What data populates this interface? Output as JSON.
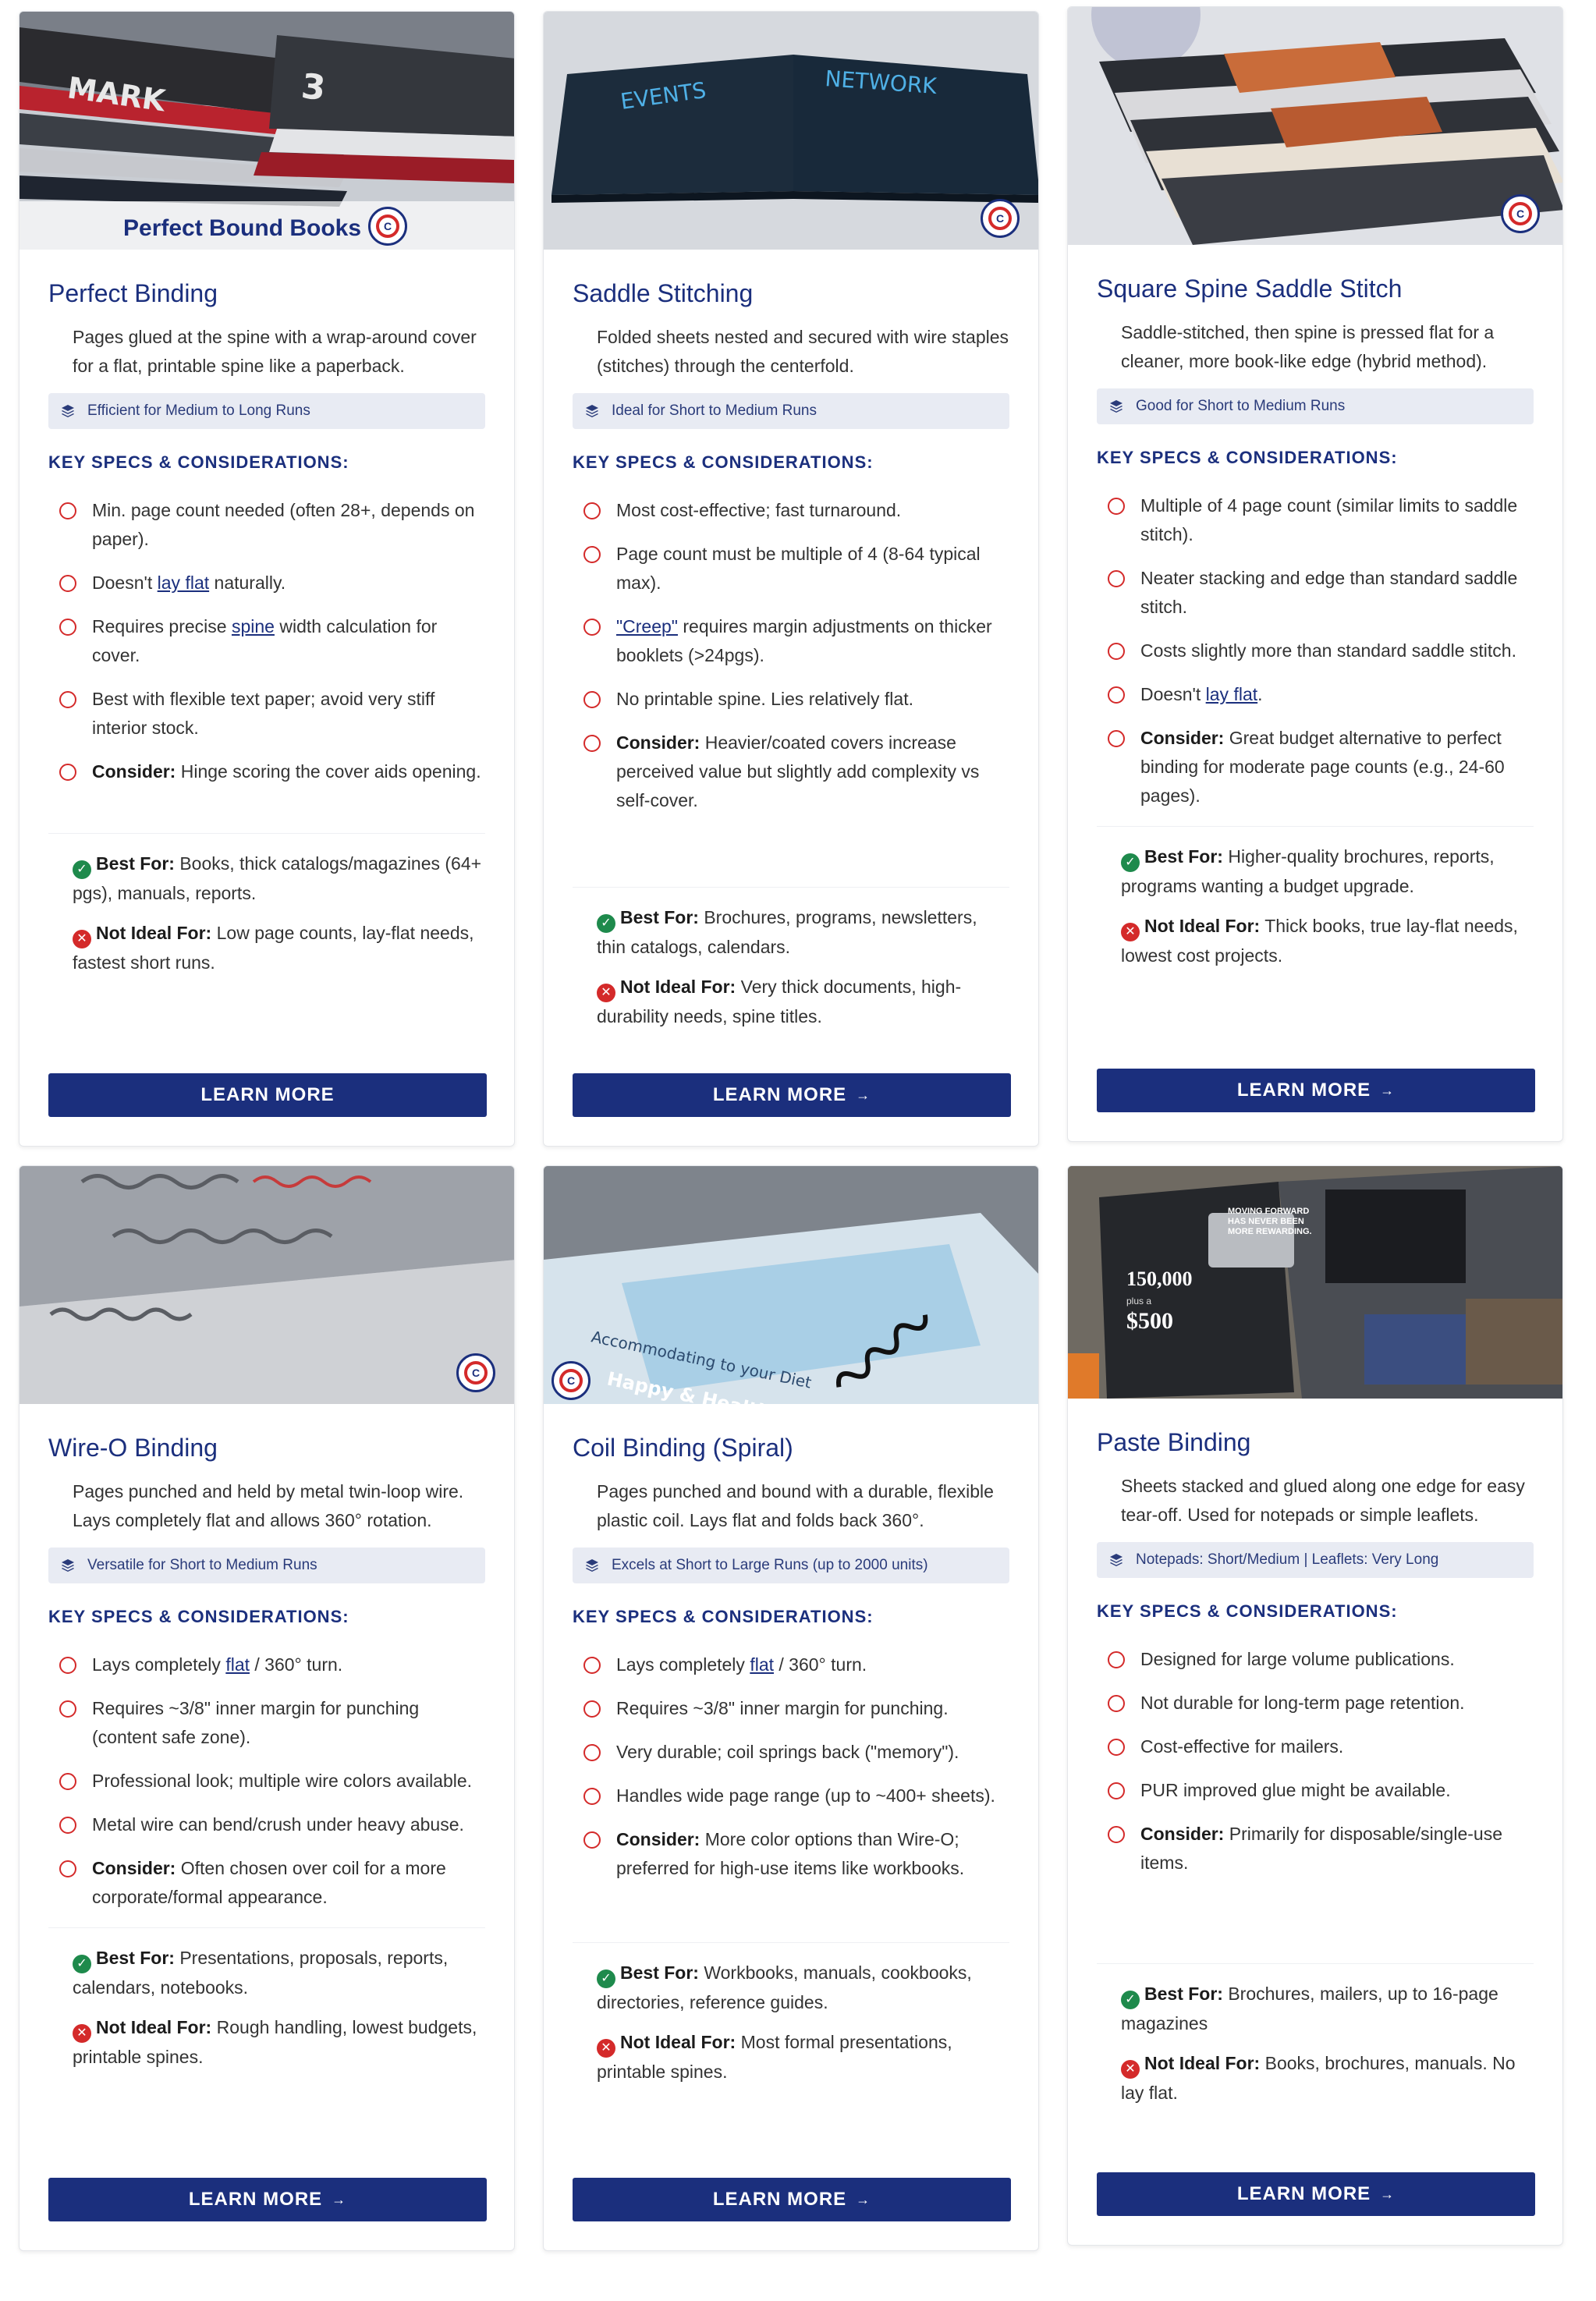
{
  "colors": {
    "brand": "#1b2f7d",
    "accent_red": "#d42a2a",
    "ok_green": "#1e8a4c"
  },
  "cards": [
    {
      "image_caption": "Perfect Bound Books",
      "title": "Perfect Binding",
      "desc": "Pages glued at the spine with a wrap-around cover for a flat, printable spine like a paperback.",
      "runs": "Efficient for Medium to Long Runs",
      "specs_heading": "KEY SPECS & CONSIDERATIONS:",
      "specs": [
        {
          "pre": "Min. page count needed (often 28+, depends on paper).",
          "link": "",
          "post": ""
        },
        {
          "pre": "Doesn't ",
          "link": "lay flat",
          "post": " naturally."
        },
        {
          "pre": "Requires precise ",
          "link": "spine",
          "post": " width calculation for cover."
        },
        {
          "pre": "Best with flexible text paper; avoid very stiff interior stock.",
          "link": "",
          "post": ""
        },
        {
          "bold": "Consider:",
          "pre": " Hinge scoring the cover aids opening.",
          "link": "",
          "post": ""
        }
      ],
      "best_label": "Best For:",
      "best": " Books, thick catalogs/magazines (64+ pgs), manuals, reports.",
      "not_label": "Not Ideal For:",
      "not": " Low page counts, lay-flat needs, fastest short runs.",
      "button": "LEARN MORE",
      "arrow": ""
    },
    {
      "title": "Saddle Stitching",
      "desc": "Folded sheets nested and secured with wire staples (stitches) through the centerfold.",
      "runs": "Ideal for Short to Medium Runs",
      "specs_heading": "KEY SPECS & CONSIDERATIONS:",
      "specs": [
        {
          "pre": "Most cost-effective; fast turnaround.",
          "link": "",
          "post": ""
        },
        {
          "pre": "Page count must be multiple of 4 (8-64 typical max).",
          "link": "",
          "post": ""
        },
        {
          "pre": "",
          "link": "\"Creep\"",
          "post": " requires margin adjustments on thicker booklets (>24pgs)."
        },
        {
          "pre": "No printable spine. Lies relatively flat.",
          "link": "",
          "post": ""
        },
        {
          "bold": "Consider:",
          "pre": " Heavier/coated covers increase perceived value but slightly add complexity vs self-cover.",
          "link": "",
          "post": ""
        }
      ],
      "best_label": "Best For:",
      "best": " Brochures, programs, newsletters, thin catalogs, calendars.",
      "not_label": "Not Ideal For:",
      "not": " Very thick documents, high-durability needs, spine titles.",
      "button": "LEARN MORE",
      "arrow": "→"
    },
    {
      "title": "Square Spine Saddle Stitch",
      "desc": "Saddle-stitched, then spine is pressed flat for a cleaner, more book-like edge (hybrid method).",
      "runs": "Good for Short to Medium Runs",
      "specs_heading": "KEY SPECS & CONSIDERATIONS:",
      "specs": [
        {
          "pre": "Multiple of 4 page count (similar limits to saddle stitch).",
          "link": "",
          "post": ""
        },
        {
          "pre": "Neater stacking and edge than standard saddle stitch.",
          "link": "",
          "post": ""
        },
        {
          "pre": "Costs slightly more than standard saddle stitch.",
          "link": "",
          "post": ""
        },
        {
          "pre": "Doesn't ",
          "link": "lay flat",
          "post": "."
        },
        {
          "bold": "Consider:",
          "pre": " Great budget alternative to perfect binding for moderate page counts (e.g., 24-60 pages).",
          "link": "",
          "post": ""
        }
      ],
      "best_label": "Best For:",
      "best": " Higher-quality brochures, reports, programs wanting a budget upgrade.",
      "not_label": "Not Ideal For:",
      "not": " Thick books, true lay-flat needs, lowest cost projects.",
      "button": "LEARN MORE",
      "arrow": "→"
    },
    {
      "title": "Wire-O Binding",
      "desc": "Pages punched and held by metal twin-loop wire. Lays completely flat and allows 360° rotation.",
      "runs": "Versatile for Short to Medium Runs",
      "specs_heading": "KEY SPECS & CONSIDERATIONS:",
      "specs": [
        {
          "pre": "Lays completely ",
          "link": "flat",
          "post": " / 360° turn."
        },
        {
          "pre": "Requires ~3/8\" inner margin for punching (content safe zone).",
          "link": "",
          "post": ""
        },
        {
          "pre": "Professional look; multiple wire colors available.",
          "link": "",
          "post": ""
        },
        {
          "pre": "Metal wire can bend/crush under heavy abuse.",
          "link": "",
          "post": ""
        },
        {
          "bold": "Consider:",
          "pre": " Often chosen over coil for a more corporate/formal appearance.",
          "link": "",
          "post": ""
        }
      ],
      "best_label": "Best For:",
      "best": " Presentations, proposals, reports, calendars, notebooks.",
      "not_label": "Not Ideal For:",
      "not": " Rough handling, lowest budgets, printable spines.",
      "button": "LEARN MORE",
      "arrow": "→"
    },
    {
      "title": "Coil Binding (Spiral)",
      "desc": "Pages punched and bound with a durable, flexible plastic coil. Lays flat and folds back 360°.",
      "runs": "Excels at Short to Large Runs (up to 2000 units)",
      "specs_heading": "KEY SPECS & CONSIDERATIONS:",
      "specs": [
        {
          "pre": "Lays completely ",
          "link": "flat",
          "post": " / 360° turn."
        },
        {
          "pre": "Requires ~3/8\" inner margin for punching.",
          "link": "",
          "post": ""
        },
        {
          "pre": "Very durable; coil springs back (\"memory\").",
          "link": "",
          "post": ""
        },
        {
          "pre": "Handles wide page range (up to ~400+ sheets).",
          "link": "",
          "post": ""
        },
        {
          "bold": "Consider:",
          "pre": " More color options than Wire-O; preferred for high-use items like workbooks.",
          "link": "",
          "post": ""
        }
      ],
      "best_label": "Best For:",
      "best": " Workbooks, manuals, cookbooks, directories, reference guides.",
      "not_label": "Not Ideal For:",
      "not": " Most formal presentations, printable spines.",
      "button": "LEARN MORE",
      "arrow": "→"
    },
    {
      "title": "Paste Binding",
      "desc": "Sheets stacked and glued along one edge for easy tear-off. Used for notepads or simple leaflets.",
      "runs": "Notepads: Short/Medium | Leaflets: Very Long",
      "specs_heading": "KEY SPECS & CONSIDERATIONS:",
      "specs": [
        {
          "pre": "Designed for large volume publications.",
          "link": "",
          "post": ""
        },
        {
          "pre": "Not durable for long-term page retention.",
          "link": "",
          "post": ""
        },
        {
          "pre": "Cost-effective for mailers.",
          "link": "",
          "post": ""
        },
        {
          "pre": "PUR improved glue might be available.",
          "link": "",
          "post": ""
        },
        {
          "bold": "Consider:",
          "pre": " Primarily for disposable/single-use items.",
          "link": "",
          "post": ""
        }
      ],
      "best_label": "Best For:",
      "best": " Brochures, mailers, up to 16-page magazines",
      "not_label": "Not Ideal For:",
      "not": " Books, brochures, manuals. No lay flat.",
      "button": "LEARN MORE",
      "arrow": "→",
      "image_text": {
        "big_number": "150,000",
        "plus_a": "plus a",
        "dollar": "$500",
        "moving": "MOVING FORWARD HAS NEVER BEEN MORE REWARDING."
      }
    }
  ]
}
